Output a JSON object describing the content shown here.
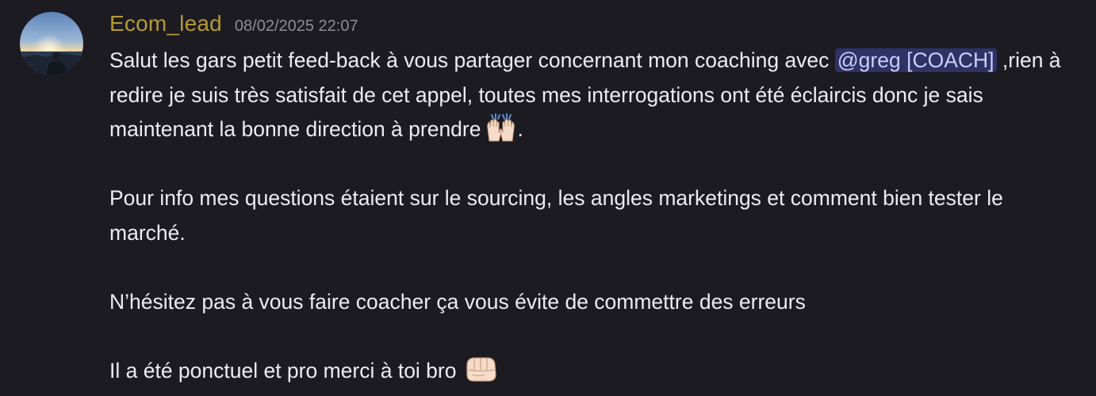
{
  "message": {
    "author": "Ecom_lead",
    "timestamp": "08/02/2025 22:07",
    "mention": "@greg [COACH]",
    "lines": {
      "p1_before": "Salut les gars petit feed-back à vous partager concernant mon coaching avec ",
      "p1_after": "  ,rien à redire je suis très satisfait de cet appel,  toutes mes interrogations ont été éclaircis donc je sais maintenant la bonne direction à prendre",
      "p1_end": ".",
      "p2": "Pour info mes questions étaient sur le sourcing, les angles marketings et comment bien tester le marché.",
      "p3": "N’hésitez pas à vous faire coacher ça vous évite de commettre des erreurs",
      "p4": "Il a été ponctuel et pro merci à toi bro "
    },
    "emojis": [
      "raising-hands-emoji",
      "oncoming-fist-emoji"
    ]
  },
  "colors": {
    "background": "#1c1b22",
    "username": "#b59a34",
    "timestamp": "#8b8c94",
    "text": "#ececf0",
    "mention_bg": "#3a3f7a",
    "mention_text": "#c9cdfb"
  }
}
